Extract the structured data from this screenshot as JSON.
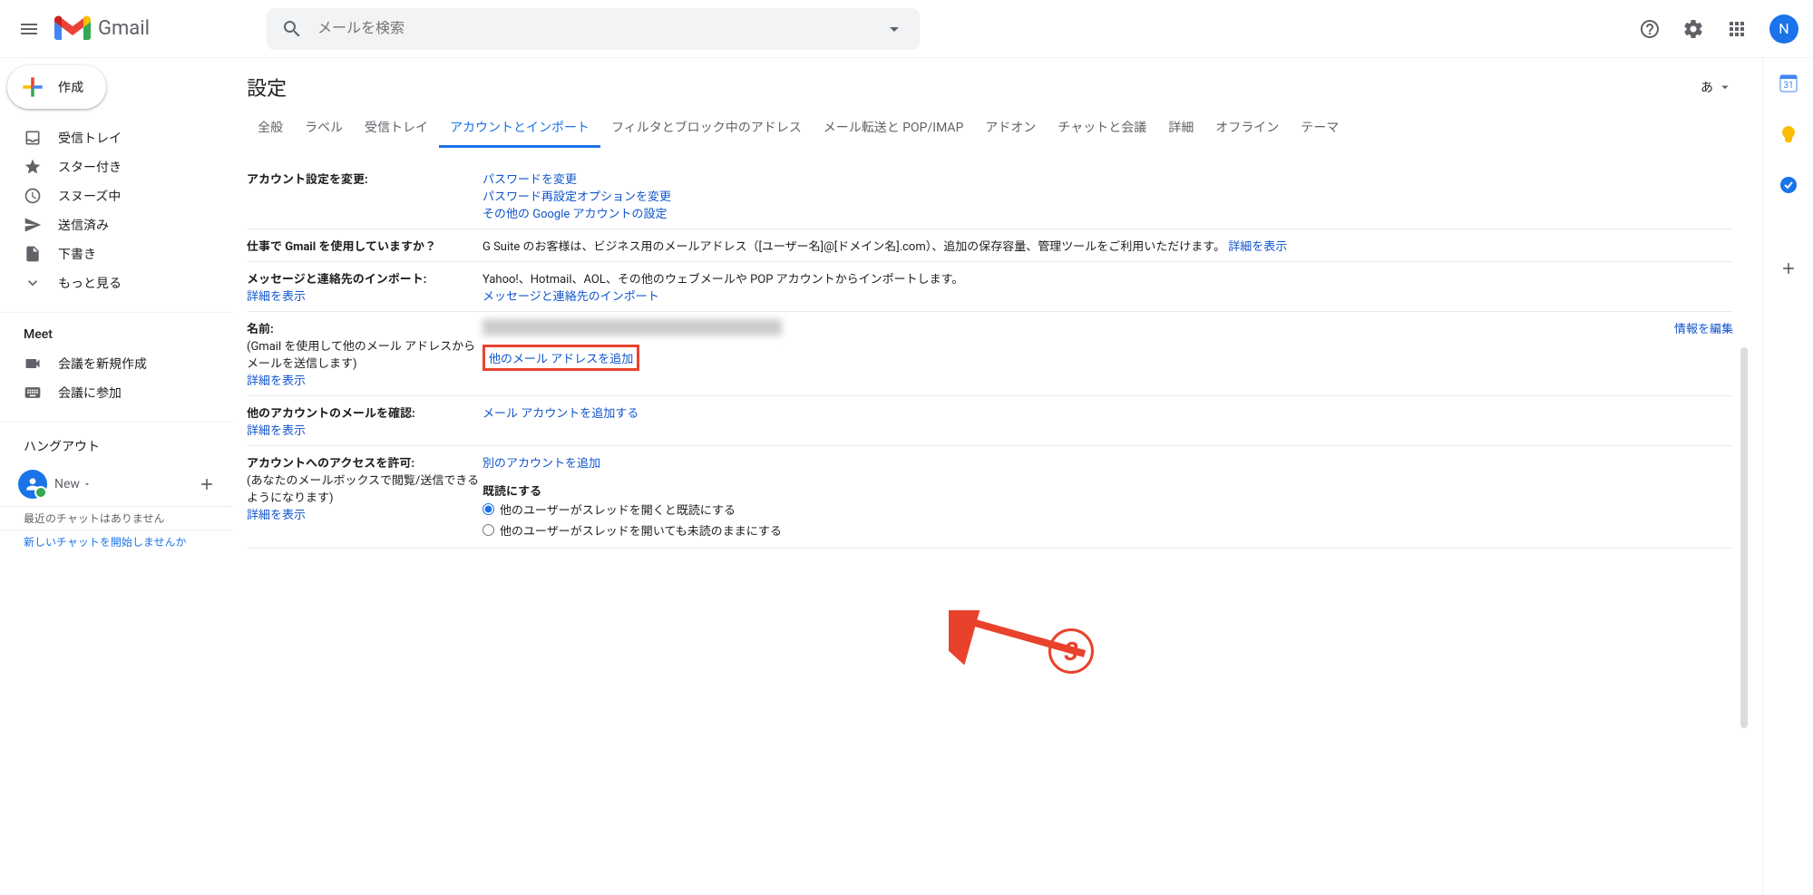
{
  "header": {
    "brand": "Gmail",
    "search_placeholder": "メールを検索",
    "avatar_initial": "N"
  },
  "sidebar": {
    "compose": "作成",
    "items": [
      {
        "label": "受信トレイ",
        "icon": "inbox"
      },
      {
        "label": "スター付き",
        "icon": "star"
      },
      {
        "label": "スヌーズ中",
        "icon": "clock"
      },
      {
        "label": "送信済み",
        "icon": "send"
      },
      {
        "label": "下書き",
        "icon": "file"
      },
      {
        "label": "もっと見る",
        "icon": "chevron"
      }
    ],
    "meet": {
      "title": "Meet",
      "new": "会議を新規作成",
      "join": "会議に参加"
    },
    "hangout": {
      "title": "ハングアウト",
      "user": "New",
      "no_recent": "最近のチャットはありません",
      "start_new": "新しいチャットを開始しませんか"
    }
  },
  "settings": {
    "title": "設定",
    "lang": "あ",
    "tabs": [
      "全般",
      "ラベル",
      "受信トレイ",
      "アカウントとインポート",
      "フィルタとブロック中のアドレス",
      "メール転送と POP/IMAP",
      "アドオン",
      "チャットと会議",
      "詳細",
      "オフライン",
      "テーマ"
    ],
    "active_tab_index": 3,
    "sections": {
      "account_change": {
        "label": "アカウント設定を変更:",
        "links": [
          "パスワードを変更",
          "パスワード再設定オプションを変更",
          "その他の Google アカウントの設定"
        ]
      },
      "gsuite": {
        "label": "仕事で Gmail を使用していますか？",
        "text": "G Suite のお客様は、ビジネス用のメールアドレス（[ユーザー名]@[ドメイン名].com）、追加の保存容量、管理ツールをご利用いただけます。",
        "details": "詳細を表示"
      },
      "import": {
        "label": "メッセージと連絡先のインポート:",
        "details": "詳細を表示",
        "text": "Yahoo!、Hotmail、AOL、その他のウェブメールや POP アカウントからインポートします。",
        "action": "メッセージと連絡先のインポート"
      },
      "name": {
        "label": "名前:",
        "sublabel": "(Gmail を使用して他のメール アドレスからメールを送信します)",
        "details": "詳細を表示",
        "add_address": "他のメール アドレスを追加",
        "edit": "情報を編集"
      },
      "check_other": {
        "label": "他のアカウントのメールを確認:",
        "details": "詳細を表示",
        "action": "メール アカウントを追加する"
      },
      "grant_access": {
        "label": "アカウントへのアクセスを許可:",
        "sublabel": "(あなたのメールボックスで閲覧/送信できるようになります)",
        "details": "詳細を表示",
        "action": "別のアカウントを追加",
        "read_label": "既読にする",
        "radio1": "他のユーザーがスレッドを開くと既読にする",
        "radio2": "他のユーザーがスレッドを開いても未読のままにする"
      }
    },
    "annotation_number": "3"
  }
}
